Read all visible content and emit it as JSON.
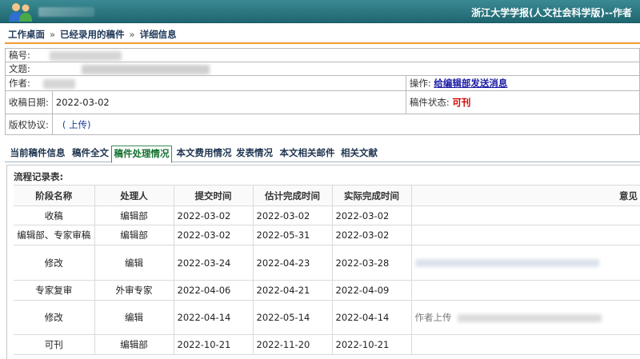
{
  "header": {
    "site_title": "浙江大学学报(人文社会科学版)--作者"
  },
  "breadcrumb": {
    "items": [
      "工作桌面",
      "已经录用的稿件",
      "详细信息"
    ],
    "separator": "»"
  },
  "manuscript": {
    "id_label": "稿号:",
    "title_label": "文题:",
    "author_label": "作者:",
    "operation_label": "操作:",
    "operation_link": "给编辑部发送消息",
    "received_label": "收稿日期:",
    "received_value": "2022-03-02",
    "status_label": "稿件状态:",
    "status_value": "可刊",
    "copyright_label": "版权协议:",
    "copyright_value": "( 上传)"
  },
  "tabs": [
    {
      "label": "当前稿件信息",
      "active": false
    },
    {
      "label": "稿件全文",
      "active": false
    },
    {
      "label": "稿件处理情况",
      "active": true
    },
    {
      "label": "本文费用情况",
      "active": false
    },
    {
      "label": "发表情况",
      "active": false
    },
    {
      "label": "本文相关邮件",
      "active": false
    },
    {
      "label": "相关文献",
      "active": false
    }
  ],
  "records": {
    "title": "流程记录表:",
    "columns": [
      "阶段名称",
      "处理人",
      "提交时间",
      "估计完成时间",
      "实际完成时间",
      "意见"
    ],
    "rows": [
      {
        "stage": "收稿",
        "handler": "编辑部",
        "submitted": "2022-03-02",
        "estimated": "2022-03-02",
        "actual": "2022-03-02",
        "opinion": ""
      },
      {
        "stage": "编辑部、专家审稿",
        "handler": "编辑部",
        "submitted": "2022-03-02",
        "estimated": "2022-05-31",
        "actual": "2022-03-02",
        "opinion": ""
      },
      {
        "stage": "修改",
        "handler": "编辑",
        "submitted": "2022-03-24",
        "estimated": "2022-04-23",
        "actual": "2022-03-28",
        "opinion": ""
      },
      {
        "stage": "专家复审",
        "handler": "外审专家",
        "submitted": "2022-04-06",
        "estimated": "2022-04-21",
        "actual": "2022-04-09",
        "opinion": ""
      },
      {
        "stage": "修改",
        "handler": "编辑",
        "submitted": "2022-04-14",
        "estimated": "2022-05-14",
        "actual": "2022-04-14",
        "opinion": "作者上传"
      },
      {
        "stage": "可刊",
        "handler": "编辑部",
        "submitted": "2022-10-21",
        "estimated": "2022-11-20",
        "actual": "2022-10-21",
        "opinion": ""
      }
    ]
  },
  "colors": {
    "header_bg": "#2a7a84",
    "accent_line": "#f29a2e",
    "status_red": "#d40000",
    "active_tab_border": "#3c8a57"
  }
}
